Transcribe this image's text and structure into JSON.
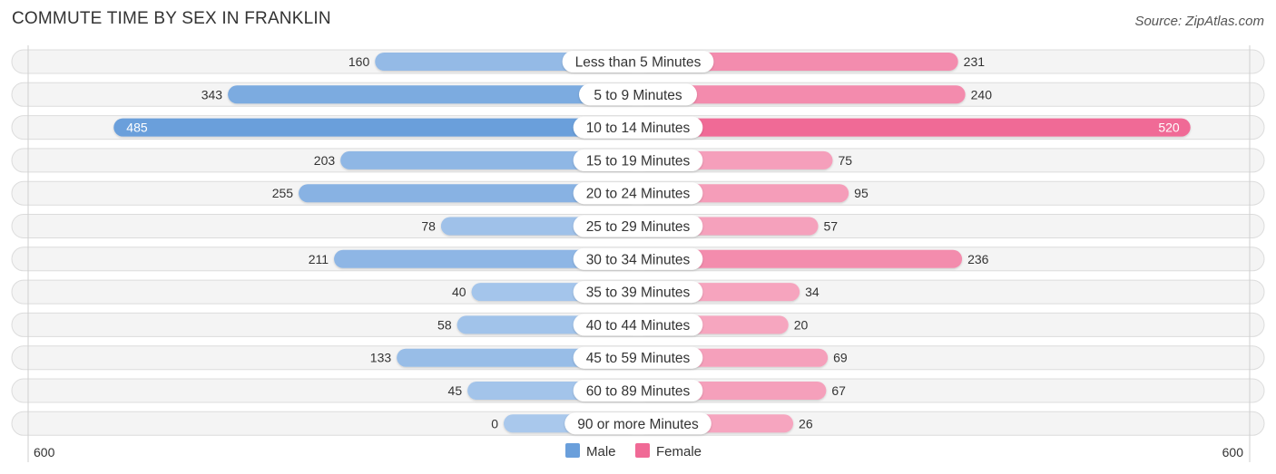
{
  "header": {
    "title": "COMMUTE TIME BY SEX IN FRANKLIN",
    "source": "Source: ZipAtlas.com"
  },
  "colors": {
    "male": "#6a9fdb",
    "male_light": "#a9c8ec",
    "female": "#f06a96",
    "female_light": "#f6a8c1"
  },
  "chart_data": {
    "type": "bar",
    "orientation": "horizontal-diverging",
    "title": "COMMUTE TIME BY SEX IN FRANKLIN",
    "categories": [
      "Less than 5 Minutes",
      "5 to 9 Minutes",
      "10 to 14 Minutes",
      "15 to 19 Minutes",
      "20 to 24 Minutes",
      "25 to 29 Minutes",
      "30 to 34 Minutes",
      "35 to 39 Minutes",
      "40 to 44 Minutes",
      "45 to 59 Minutes",
      "60 to 89 Minutes",
      "90 or more Minutes"
    ],
    "series": [
      {
        "name": "Male",
        "values": [
          160,
          343,
          485,
          203,
          255,
          78,
          211,
          40,
          58,
          133,
          45,
          0
        ]
      },
      {
        "name": "Female",
        "values": [
          231,
          240,
          520,
          75,
          95,
          57,
          236,
          34,
          20,
          69,
          67,
          26
        ]
      }
    ],
    "axis": {
      "left_label": "600",
      "right_label": "600",
      "max": 600
    },
    "legend": {
      "position": "bottom-center",
      "items": [
        "Male",
        "Female"
      ]
    },
    "grid": false
  }
}
